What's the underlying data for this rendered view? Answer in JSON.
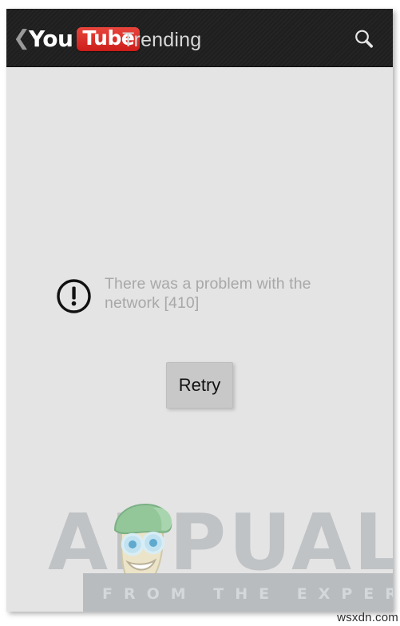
{
  "app": {
    "name": "YouTube",
    "logo_word_1": "You",
    "logo_word_2": "Tube",
    "brand_red": "#cc1d1a"
  },
  "actionbar": {
    "back_icon": "chevron-left-icon",
    "title": "Trending",
    "search_icon": "search-icon",
    "background_color": "#1f1f1f",
    "title_color": "#d8d8d8"
  },
  "content": {
    "background_color": "#e4e4e4",
    "error": {
      "icon": "alert-circle-icon",
      "message": "There was a problem with the network [410]",
      "text_color": "#a8a8a8"
    },
    "retry_button": {
      "label": "Retry",
      "background_color": "#c8c8c8",
      "text_color": "#101010"
    }
  },
  "watermark": {
    "brand": "APPUALS",
    "tagline": "FROM THE EXPERTS",
    "mascot": "mascot-face-icon",
    "brand_color": "#c0c3c5",
    "band_color": "#b9bcbe"
  },
  "overlay": {
    "site_tag": "wsxdn.com"
  }
}
